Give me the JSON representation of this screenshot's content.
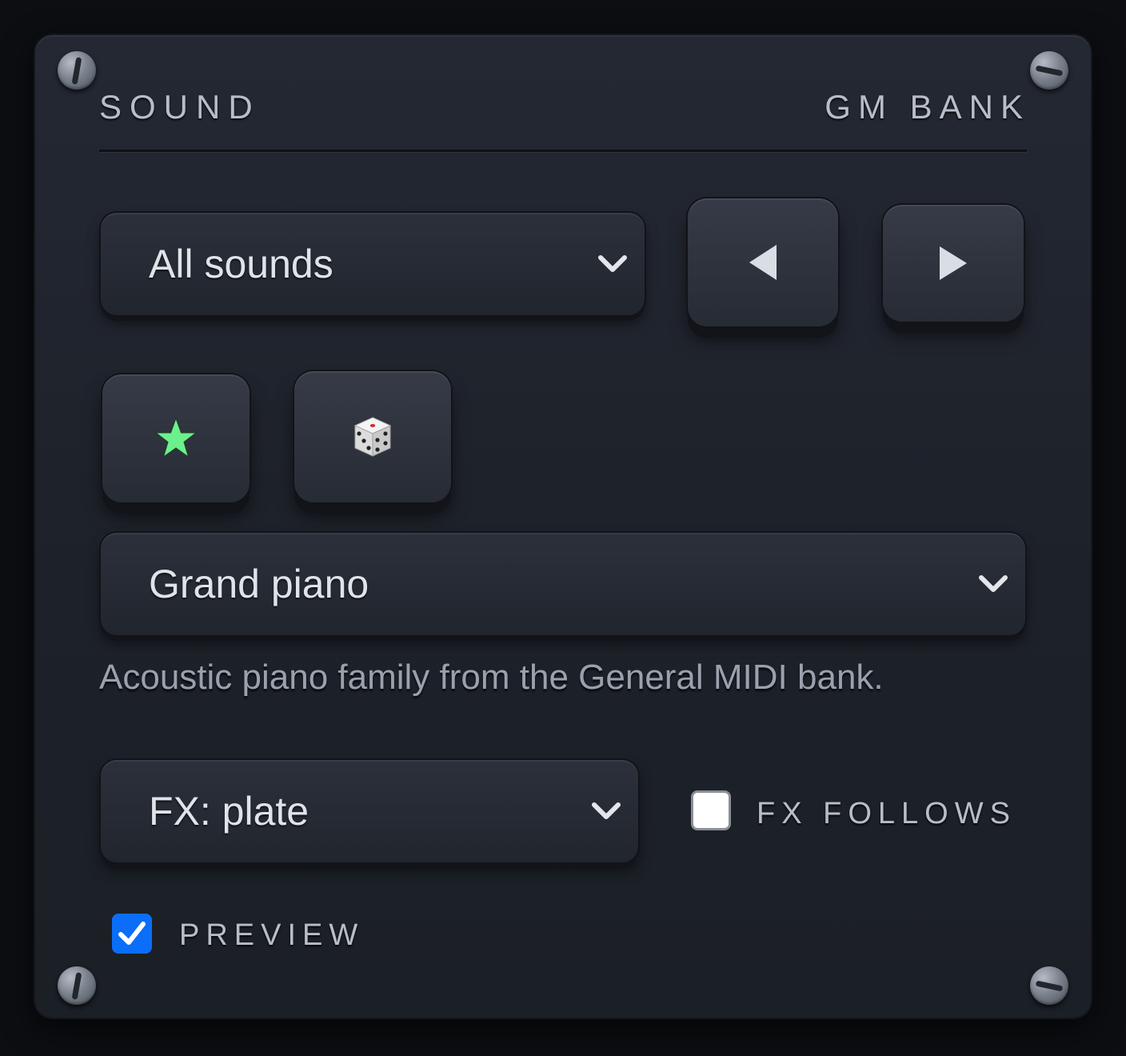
{
  "panel": {
    "title_left": "SOUND",
    "title_right": "GM BANK"
  },
  "category_select": {
    "value": "All sounds"
  },
  "nav": {
    "prev_icon": "triangle-left-icon",
    "next_icon": "triangle-right-icon"
  },
  "actions": {
    "favorite_icon": "star-icon",
    "random_icon": "dice-icon"
  },
  "sound_select": {
    "value": "Grand piano",
    "description": "Acoustic piano family from the General MIDI bank."
  },
  "fx_select": {
    "value": "FX: plate"
  },
  "fx_follows": {
    "label": "FX FOLLOWS",
    "checked": false
  },
  "preview": {
    "label": "PREVIEW",
    "checked": true
  },
  "colors": {
    "accent_blue": "#0b6ef9",
    "star_green": "#6cf08c",
    "panel_bg": "#1f232b"
  }
}
